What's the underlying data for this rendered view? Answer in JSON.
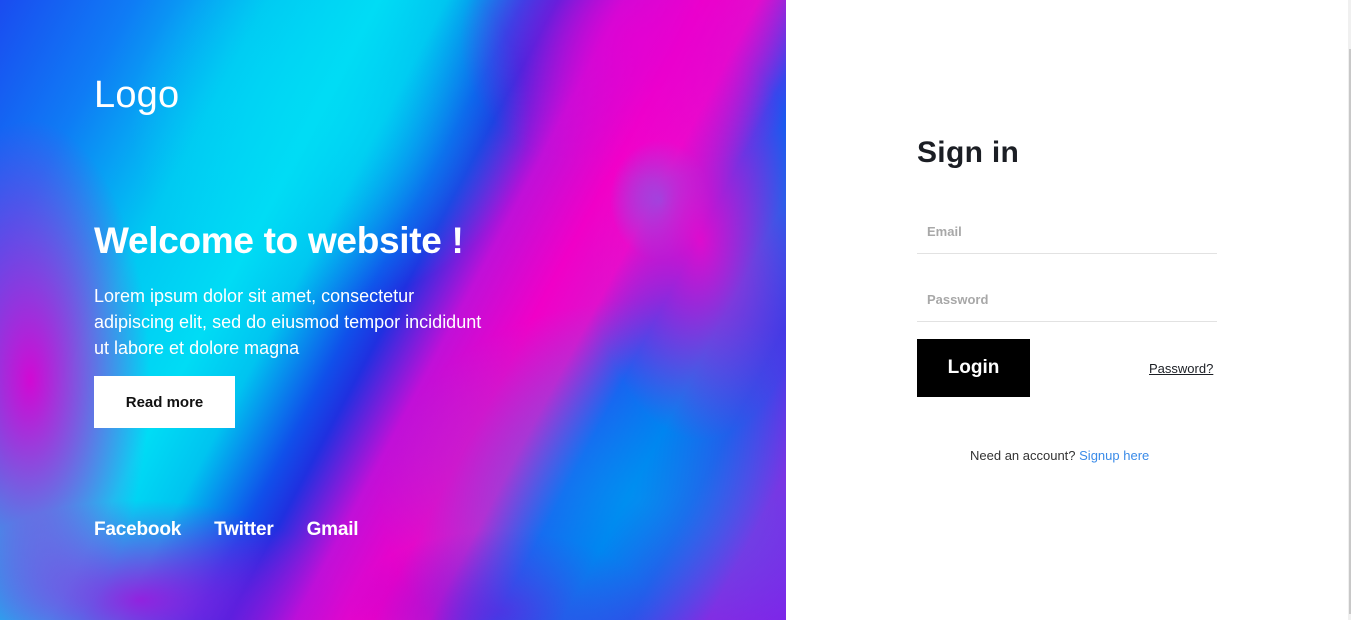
{
  "hero": {
    "logo": "Logo",
    "title": "Welcome to website !",
    "description": "Lorem ipsum dolor sit amet, consectetur adipiscing elit, sed do eiusmod tempor incididunt ut labore et dolore magna",
    "read_more_label": "Read more",
    "socials": [
      {
        "label": "Facebook"
      },
      {
        "label": "Twitter"
      },
      {
        "label": "Gmail"
      }
    ]
  },
  "signin": {
    "title": "Sign in",
    "email": {
      "placeholder": "Email",
      "value": ""
    },
    "password": {
      "placeholder": "Password",
      "value": ""
    },
    "login_label": "Login",
    "forgot_label": "Password?",
    "signup_prompt": "Need an account?",
    "signup_label": "Signup here"
  },
  "colors": {
    "background_palette": [
      "#00dcf5",
      "#0a48f0",
      "#f000c8",
      "#8a18e8"
    ],
    "login_button": "#000000",
    "signup_link": "#3a8be8",
    "heading_text": "#1b1e24"
  }
}
